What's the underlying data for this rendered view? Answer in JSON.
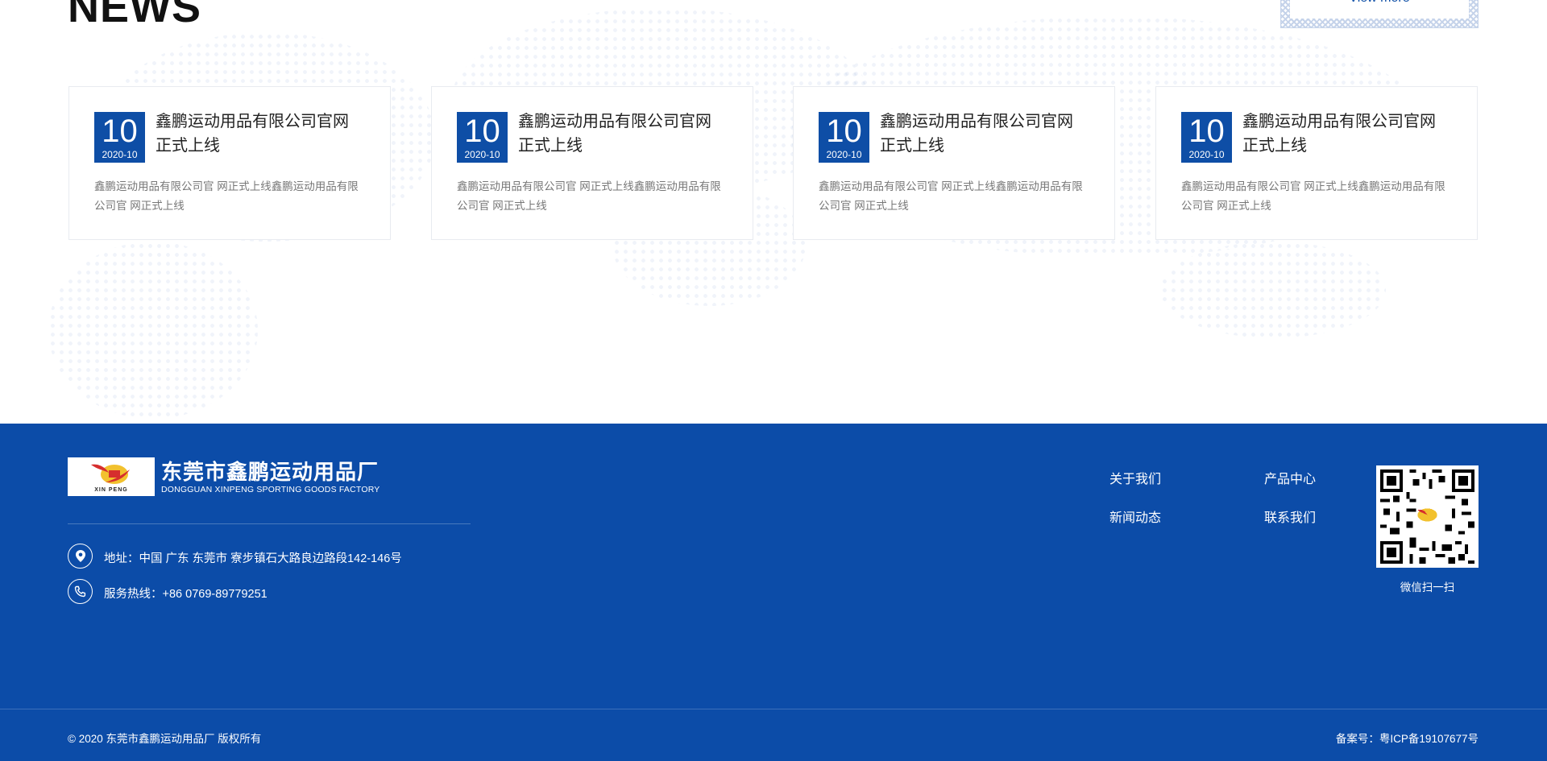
{
  "news": {
    "title": "NEWS",
    "view_more": "View more",
    "items": [
      {
        "day": "10",
        "ym": "2020-10",
        "title": "鑫鹏运动用品有限公司官网正式上线",
        "desc": "鑫鹏运动用品有限公司官 网正式上线鑫鹏运动用品有限公司官 网正式上线"
      },
      {
        "day": "10",
        "ym": "2020-10",
        "title": "鑫鹏运动用品有限公司官网正式上线",
        "desc": "鑫鹏运动用品有限公司官 网正式上线鑫鹏运动用品有限公司官 网正式上线"
      },
      {
        "day": "10",
        "ym": "2020-10",
        "title": "鑫鹏运动用品有限公司官网正式上线",
        "desc": "鑫鹏运动用品有限公司官 网正式上线鑫鹏运动用品有限公司官 网正式上线"
      },
      {
        "day": "10",
        "ym": "2020-10",
        "title": "鑫鹏运动用品有限公司官网正式上线",
        "desc": "鑫鹏运动用品有限公司官 网正式上线鑫鹏运动用品有限公司官 网正式上线"
      }
    ]
  },
  "footer": {
    "logo_sub": "XIN PENG",
    "brand_cn": "东莞市鑫鹏运动用品厂",
    "brand_en": "DONGGUAN XINPENG SPORTING GOODS FACTORY",
    "address": "地址：中国 广东 东莞市 寮步镇石大路良边路段142-146号",
    "hotline": "服务热线：+86 0769-89779251",
    "nav": {
      "about": "关于我们",
      "products": "产品中心",
      "news": "新闻动态",
      "contact": "联系我们"
    },
    "qr_label": "微信扫一扫",
    "copyright": "© 2020 东莞市鑫鹏运动用品厂  版权所有",
    "icp": "备案号：粤ICP备19107677号"
  },
  "colors": {
    "primary_blue": "#0c4ca8",
    "badge_blue": "#0e4ea6"
  }
}
